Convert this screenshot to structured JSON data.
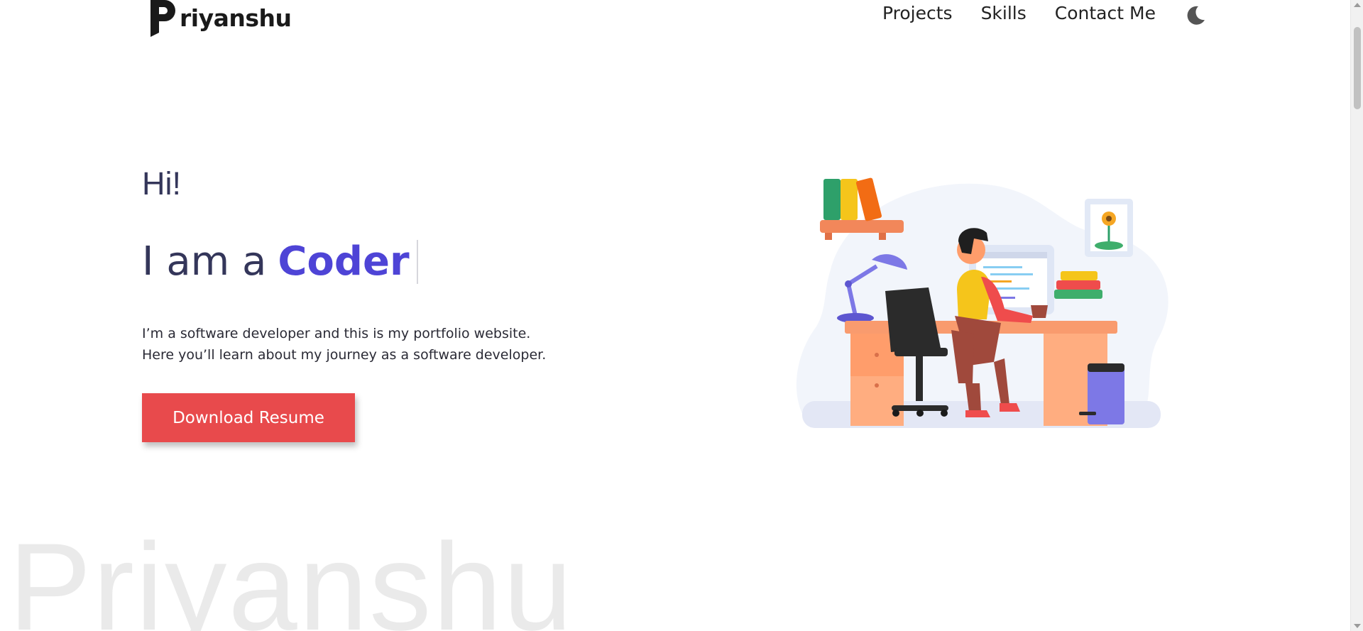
{
  "header": {
    "logo_text": "riyanshu",
    "nav": [
      "Projects",
      "Skills",
      "Contact Me"
    ],
    "theme_toggle_icon": "moon-icon"
  },
  "hero": {
    "greeting": "Hi!",
    "intro_prefix": "I am a",
    "role": "Coder",
    "description_line1": "I’m a software developer and this is my portfolio website.",
    "description_line2": "Here you’ll learn about my journey as a software developer.",
    "button_label": "Download Resume",
    "illustration": "developer-at-desk-illustration"
  },
  "watermark": "Priyanshu",
  "colors": {
    "accent": "#4e44d6",
    "heading": "#34365a",
    "button": "#e84a4c",
    "watermark": "#eaeaea"
  }
}
